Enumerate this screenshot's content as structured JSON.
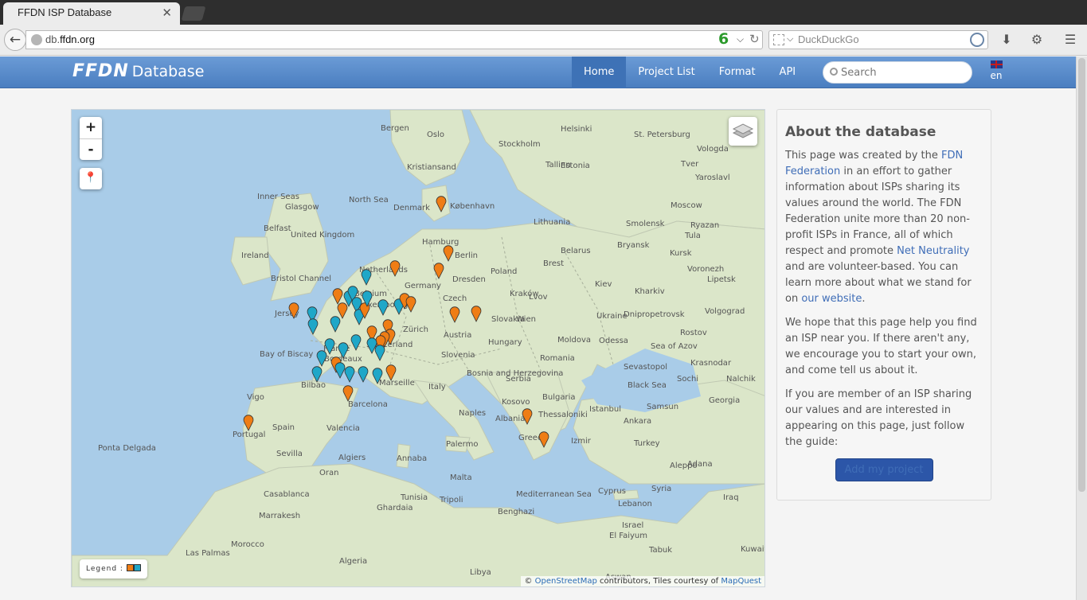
{
  "browser": {
    "tab_title": "FFDN ISP Database",
    "tab_close": "✕",
    "url_prefix": "db.",
    "url_domain": "ffdn.org",
    "count_badge": "6",
    "search_engine_placeholder": "DuckDuckGo"
  },
  "header": {
    "brand_logo": "FFDN",
    "brand_name": "Database",
    "nav": [
      "Home",
      "Project List",
      "Format",
      "API"
    ],
    "active_nav": "Home",
    "search_placeholder": "Search",
    "lang": "en"
  },
  "map": {
    "zoom_in": "+",
    "zoom_out": "-",
    "legend_label": "Legend :",
    "legend_colors": [
      "#ef7d15",
      "#1fa7c8"
    ],
    "attribution_prefix": "© ",
    "attribution_osm": "OpenStreetMap",
    "attribution_mid": " contributors, Tiles courtesy of ",
    "attribution_mq": "MapQuest",
    "labels": [
      "Bergen",
      "Oslo",
      "Stockholm",
      "Helsinki",
      "St. Petersburg",
      "Vologda",
      "Tver",
      "Yaroslavl",
      "Tallinn",
      "Estonia",
      "Kristiansand",
      "Inner Seas",
      "Glasgow",
      "North Sea",
      "Denmark",
      "København",
      "Moscow",
      "Smolensk",
      "Ryazan",
      "Tula",
      "Belfast",
      "United Kingdom",
      "Ireland",
      "Lithuania",
      "Hamburg",
      "Berlin",
      "Netherlands",
      "Bristol Channel",
      "Belarus",
      "Brest",
      "Bryansk",
      "Kursk",
      "Voronezh",
      "Germany",
      "Dresden",
      "Poland",
      "Kiev",
      "Lipetsk",
      "Jersey",
      "Belgium",
      "Luxembourg",
      "Czech",
      "Kraków",
      "Lvov",
      "Kharkiv",
      "Zürich",
      "Slovakia",
      "Ukraine",
      "Dnipropetrovsk",
      "Volgograd",
      "Austria",
      "Wien",
      "Rostov",
      "Bay of Biscay",
      "France",
      "Switzerland",
      "Hungary",
      "Moldova",
      "Odessa",
      "Sea of Azov",
      "Bordeaux",
      "Slovenia",
      "Romania",
      "Sevastopol",
      "Krasnodar",
      "Bosnia and Herzegovina",
      "Serbia",
      "Sochi",
      "Nalchik",
      "Bilbao",
      "Marseille",
      "Italy",
      "Black Sea",
      "Bulgaria",
      "Georgia",
      "Vigo",
      "Barcelona",
      "Kosovo",
      "Istanbul",
      "Samsun",
      "Albania",
      "Thessaloniki",
      "Naples",
      "Ankara",
      "Spain",
      "Valencia",
      "Portugal",
      "Greece",
      "Turkey",
      "Ponta Delgada",
      "Sevilla",
      "Palermo",
      "Izmir",
      "Algiers",
      "Annaba",
      "Oran",
      "Malta",
      "Adana",
      "Aleppo",
      "Casablanca",
      "Tunisia",
      "Tripoli",
      "Mediterranean Sea",
      "Cyprus",
      "Syria",
      "Iraq",
      "Marrakesh",
      "Ghardaia",
      "Benghazi",
      "Lebanon",
      "Israel",
      "Morocco",
      "El Faiyum",
      "Tabuk",
      "Kuwait",
      "Las Palmas",
      "Algeria",
      "Libya",
      "Aswan"
    ]
  },
  "about": {
    "title": "About the database",
    "p1_before": "This page was created by the ",
    "p1_link": "FDN Federation",
    "p1_mid": " in an effort to gather information about ISPs sharing its values around the world. The FDN Federation unite more than 20 non-profit ISPs in France, all of which respect and promote ",
    "p1_link2": "Net Neutrality",
    "p1_mid2": " and are volunteer-based. You can learn more about what we stand for on ",
    "p1_link3": "our website",
    "p1_end": ".",
    "p2": "We hope that this page help you find an ISP near you. If there aren't any, we encourage you to start your own, and come tell us about it.",
    "p3": "If you are member of an ISP sharing our values and are interested in appearing on this page, just follow the guide:",
    "button": "Add my project"
  }
}
